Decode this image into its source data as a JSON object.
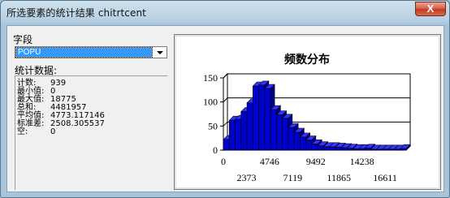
{
  "window": {
    "title": "所选要素的统计结果 chitrtcent",
    "close_label": "X"
  },
  "field": {
    "label": "字段",
    "selected": "POPU"
  },
  "stats": {
    "title": "统计数据:",
    "rows": [
      {
        "key": "计数:",
        "value": "939"
      },
      {
        "key": "最小值:",
        "value": "0"
      },
      {
        "key": "最大值:",
        "value": "18775"
      },
      {
        "key": "总和:",
        "value": "4481957"
      },
      {
        "key": "平均值:",
        "value": "4773.117146"
      },
      {
        "key": "标准差:",
        "value": "2508.305537"
      },
      {
        "key": "空:",
        "value": "0"
      }
    ]
  },
  "chart_data": {
    "type": "bar",
    "title": "频数分布",
    "ylim": [
      0,
      150
    ],
    "y_ticks": [
      "0",
      "50",
      "100",
      "150"
    ],
    "x_ticks_top": [
      "0",
      "4746",
      "9492",
      "14238"
    ],
    "x_ticks_bottom": [
      "2373",
      "7119",
      "11865",
      "16611"
    ],
    "xlim": [
      0,
      18775
    ],
    "values": [
      22,
      62,
      64,
      80,
      98,
      133,
      135,
      128,
      84,
      73,
      66,
      47,
      37,
      27,
      21,
      13,
      9,
      7,
      7,
      6,
      5,
      4,
      3,
      3,
      4,
      2,
      2,
      2,
      2,
      2,
      3
    ],
    "grid": true,
    "bar_color": "#0000cc"
  }
}
